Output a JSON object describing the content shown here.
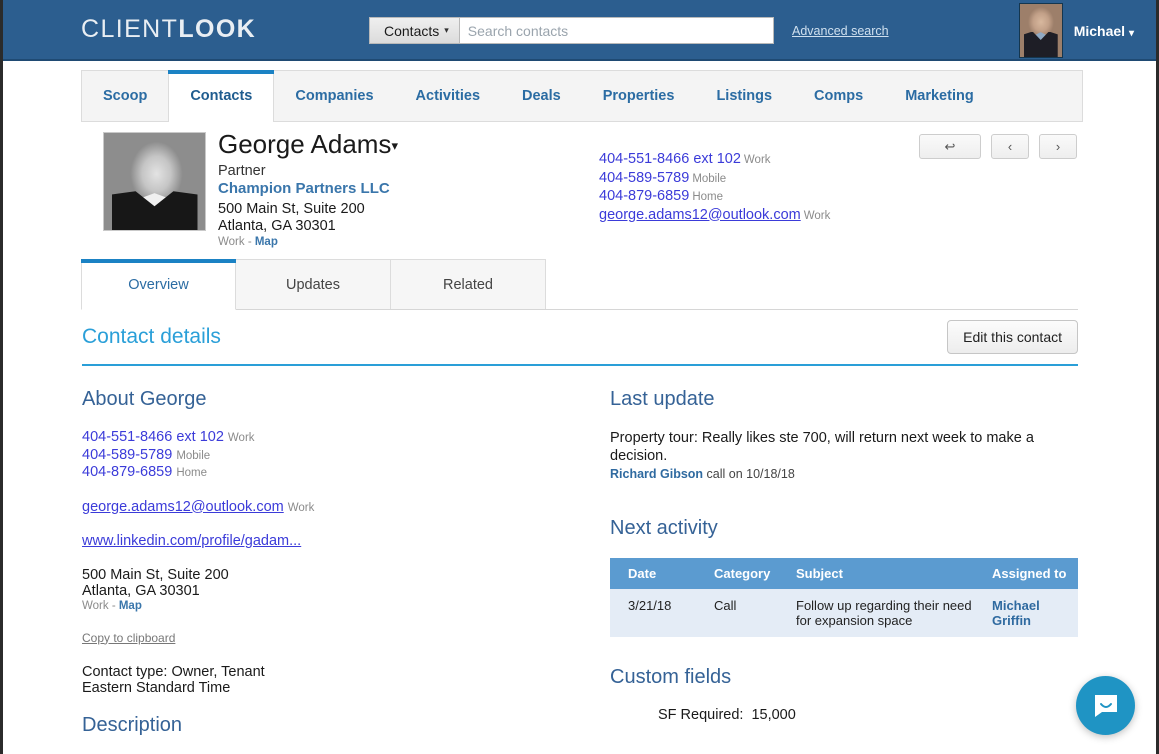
{
  "header": {
    "logo_light": "CLIENT",
    "logo_bold": "LOOK",
    "search_scope": "Contacts",
    "search_placeholder": "Search contacts",
    "search_value": "",
    "advanced_search": "Advanced search",
    "user_name": "Michael",
    "caret": "▾",
    "bg_color": "#2c5e8f"
  },
  "main_nav": {
    "tabs": [
      {
        "label": "Scoop",
        "active": false
      },
      {
        "label": "Contacts",
        "active": true
      },
      {
        "label": "Companies",
        "active": false
      },
      {
        "label": "Activities",
        "active": false
      },
      {
        "label": "Deals",
        "active": false
      },
      {
        "label": "Properties",
        "active": false
      },
      {
        "label": "Listings",
        "active": false
      },
      {
        "label": "Comps",
        "active": false
      },
      {
        "label": "Marketing",
        "active": false
      }
    ],
    "accent_color": "#1b82c4"
  },
  "contact": {
    "name": "George Adams",
    "name_caret": "▾",
    "title": "Partner",
    "company": "Champion Partners LLC",
    "address_line1": "500 Main St, Suite 200",
    "address_line2": "Atlanta, GA 30301",
    "address_label": "Work - ",
    "map_link": "Map",
    "contacts": [
      {
        "value": "404-551-8466 ext 102",
        "label": "Work",
        "link": false
      },
      {
        "value": "404-589-5789",
        "label": "Mobile",
        "link": false
      },
      {
        "value": "404-879-6859",
        "label": "Home",
        "link": false
      },
      {
        "value": "george.adams12@outlook.com",
        "label": "Work",
        "link": true
      }
    ],
    "nav_buttons": [
      {
        "icon": "↩",
        "name": "back-button"
      },
      {
        "icon": "‹",
        "name": "previous-contact-button"
      },
      {
        "icon": "›",
        "name": "next-contact-button"
      }
    ]
  },
  "sub_tabs": [
    {
      "label": "Overview",
      "active": true
    },
    {
      "label": "Updates",
      "active": false
    },
    {
      "label": "Related",
      "active": false
    }
  ],
  "details": {
    "title": "Contact details",
    "edit_button": "Edit this contact",
    "accent_color": "#2a9fd8"
  },
  "about": {
    "heading": "About George",
    "contacts": [
      {
        "value": "404-551-8466 ext 102",
        "label": "Work",
        "link": false
      },
      {
        "value": "404-589-5789",
        "label": "Mobile",
        "link": false
      },
      {
        "value": "404-879-6859",
        "label": "Home",
        "link": false
      }
    ],
    "email": "george.adams12@outlook.com",
    "email_label": "Work",
    "website": "www.linkedin.com/profile/gadam...",
    "address_line1": "500 Main St, Suite 200",
    "address_line2": "Atlanta, GA 30301",
    "address_label": "Work - ",
    "map_link": "Map",
    "copy_to_clipboard": "Copy to clipboard",
    "contact_type": "Contact type: Owner, Tenant",
    "timezone": "Eastern Standard Time"
  },
  "description": {
    "heading": "Description"
  },
  "last_update": {
    "heading": "Last update",
    "text": "Property tour: Really likes ste 700, will return next week to make a decision.",
    "author": "Richard Gibson",
    "meta": " call on 10/18/18"
  },
  "next_activity": {
    "heading": "Next activity",
    "columns": [
      "Date",
      "Category",
      "Subject",
      "Assigned to"
    ],
    "rows": [
      {
        "date": "3/21/18",
        "category": "Call",
        "subject": "Follow up regarding their need for expansion space",
        "assigned_to": "Michael Griffin"
      }
    ],
    "header_color": "#5b9bd0",
    "row_color": "#e4ecf6"
  },
  "custom_fields": {
    "heading": "Custom fields",
    "fields": [
      {
        "label": "SF Required:",
        "value": "15,000"
      }
    ]
  },
  "chat_widget": {
    "icon": "chat-bubble-icon",
    "color": "#1f94c4"
  }
}
